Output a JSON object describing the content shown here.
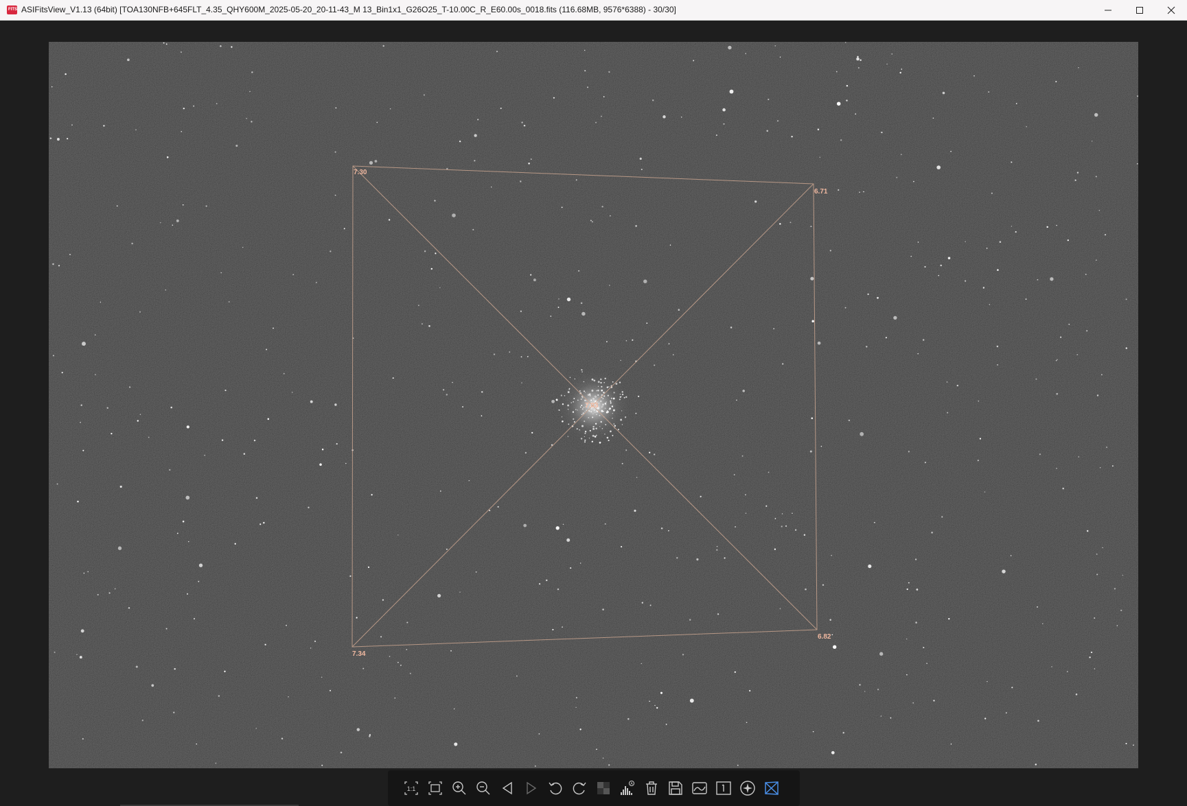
{
  "window": {
    "title": "ASIFitsView_V1.13 (64bit) [TOA130NFB+645FLT_4.35_QHY600M_2025-05-20_20-11-43_M 13_Bin1x1_G26O25_T-10.00C_R_E60.00s_0018.fits (116.68MB, 9576*6388) - 30/30]",
    "app_icon_text": "FITS",
    "controls": [
      "minimize-icon",
      "maximize-icon",
      "close-icon"
    ]
  },
  "image": {
    "corner_labels": {
      "top_left": "7.30",
      "top_right": "6.71",
      "bottom_left": "7.34",
      "bottom_right": "6.82",
      "center": "7.03"
    },
    "label_color": "#f0b8a0",
    "line_color": "#c9a48f"
  },
  "toolbar": {
    "buttons": [
      {
        "name": "actual-size-button",
        "icon": "actual-size-1to1-icon"
      },
      {
        "name": "fit-window-button",
        "icon": "fit-window-icon"
      },
      {
        "name": "zoom-in-button",
        "icon": "zoom-in-icon"
      },
      {
        "name": "zoom-out-button",
        "icon": "zoom-out-icon"
      },
      {
        "name": "previous-image-button",
        "icon": "triangle-left-icon"
      },
      {
        "name": "next-image-button",
        "icon": "triangle-right-icon",
        "disabled": true
      },
      {
        "name": "rotate-left-button",
        "icon": "rotate-ccw-icon"
      },
      {
        "name": "rotate-right-button",
        "icon": "rotate-cw-icon"
      },
      {
        "name": "debayer-button",
        "icon": "bayer-pattern-icon"
      },
      {
        "name": "auto-stretch-button",
        "icon": "histogram-auto-icon"
      },
      {
        "name": "delete-button",
        "icon": "trash-icon"
      },
      {
        "name": "save-button",
        "icon": "floppy-disk-icon"
      },
      {
        "name": "image-info-button",
        "icon": "image-stats-icon"
      },
      {
        "name": "single-channel-button",
        "icon": "channel-one-icon"
      },
      {
        "name": "star-detect-button",
        "icon": "star-icon"
      },
      {
        "name": "tilt-analysis-button",
        "icon": "tilt-analysis-icon",
        "active": true
      }
    ],
    "active_color": "#4a8fe8",
    "icon_color": "#c8c8c8",
    "disabled_color": "#6a6a6a"
  }
}
